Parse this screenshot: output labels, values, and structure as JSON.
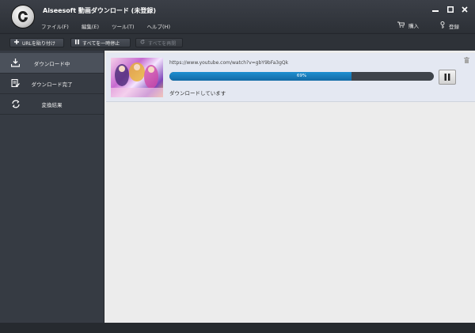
{
  "app": {
    "title": "Aiseesoft 動画ダウンロード (未登録)"
  },
  "menu": [
    {
      "label": "ファイル(F)"
    },
    {
      "label": "編集(E)"
    },
    {
      "label": "ツール(T)"
    },
    {
      "label": "ヘルプ(H)"
    }
  ],
  "header_actions": {
    "buy_label": "購入",
    "register_label": "登録"
  },
  "toolbar": {
    "paste_url_label": "URLを貼り付け",
    "pause_all_label": "すべてを一時停止",
    "resume_all_label": "すべてを再開"
  },
  "sidebar": {
    "items": [
      {
        "label": "ダウンロード中"
      },
      {
        "label": "ダウンロード完了"
      },
      {
        "label": "変換結果"
      }
    ]
  },
  "download": {
    "url": "https://www.youtube.com/watch?v=gbY9bFa3gQk",
    "progress_text": "69%",
    "progress_value": 0.69,
    "status": "ダウンロードしています"
  },
  "colors": {
    "accent": "#1a7fc0",
    "sidebar_bg": "#363b43",
    "content_bg": "#ececec",
    "active_row": "#e4e8f2"
  },
  "icons": {
    "logo": "app-logo",
    "minimize": "minimize-icon",
    "maximize": "maximize-icon",
    "close": "close-icon",
    "cart": "cart-icon",
    "key": "key-icon",
    "plus": "plus-icon",
    "pause": "pause-icon",
    "refresh": "refresh-icon",
    "download": "download-icon",
    "completed": "downloaded-file-icon",
    "convert": "convert-icon",
    "trash": "trash-icon"
  }
}
